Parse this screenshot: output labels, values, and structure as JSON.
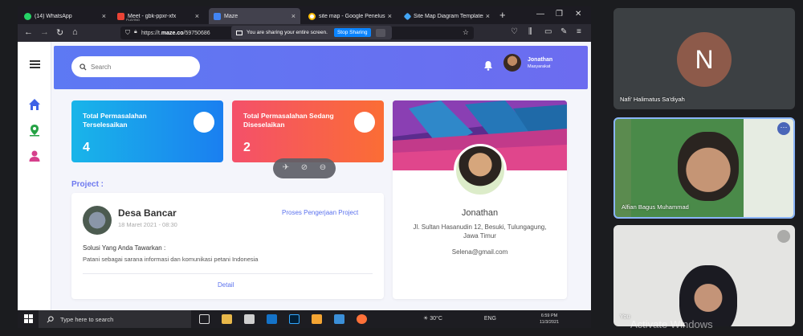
{
  "browser": {
    "tabs": [
      {
        "title": "(14) WhatsApp",
        "sub": "",
        "color": "#25d366",
        "active": false
      },
      {
        "title": "Meet - gbk-ppxr-xfx",
        "sub": "PLAYING",
        "color": "#ea4335",
        "active": false
      },
      {
        "title": "Maze",
        "sub": "",
        "color": "#4285f4",
        "active": true
      },
      {
        "title": "site map - Google Penelusur",
        "sub": "",
        "color": "#fbbc05",
        "active": false
      },
      {
        "title": "Site Map Diagram Templates",
        "sub": "",
        "color": "#42a5f5",
        "active": false
      }
    ],
    "url_prefix": "https://t.",
    "url_domain": "maze.co",
    "url_rest": "/59750686",
    "share_text": "You are sharing your entire screen.",
    "stop_label": "Stop Sharing"
  },
  "app": {
    "search_placeholder": "Search",
    "user_name": "Jonathan",
    "user_role": "Masyarakat",
    "stat1_label": "Total Permasalahan Terselesaikan",
    "stat1_value": "4",
    "stat2_label": "Total Permasalahan Sedang Diseselaikan",
    "stat2_value": "2",
    "project_section": "Project :",
    "project": {
      "name": "Desa Bancar",
      "date": "18 Maret 2021 - 08:30",
      "status": "Proses Pengerjaan Project",
      "solution_heading": "Solusi Yang Anda Tawarkan :",
      "solution": "Patani sebagai sarana informasi dan komunikasi petani Indonesia",
      "detail": "Detail"
    },
    "profile": {
      "name": "Jonathan",
      "address": "Jl. Sultan Hasanudin 12, Besuki, Tulungagung, Jawa Timur",
      "email": "Selena@gmail.com"
    }
  },
  "taskbar": {
    "search_placeholder": "Type here to search",
    "weather": "30°C",
    "lang": "ENG",
    "time": "6:59 PM",
    "date": "11/3/2021"
  },
  "meet": {
    "p1_name": "Nafi' Halimatus Sa'diyah",
    "p1_initial": "N",
    "p2_name": "Alfian Bagus Muhammad",
    "p3_name": "You"
  },
  "watermark": "Activate Windows"
}
